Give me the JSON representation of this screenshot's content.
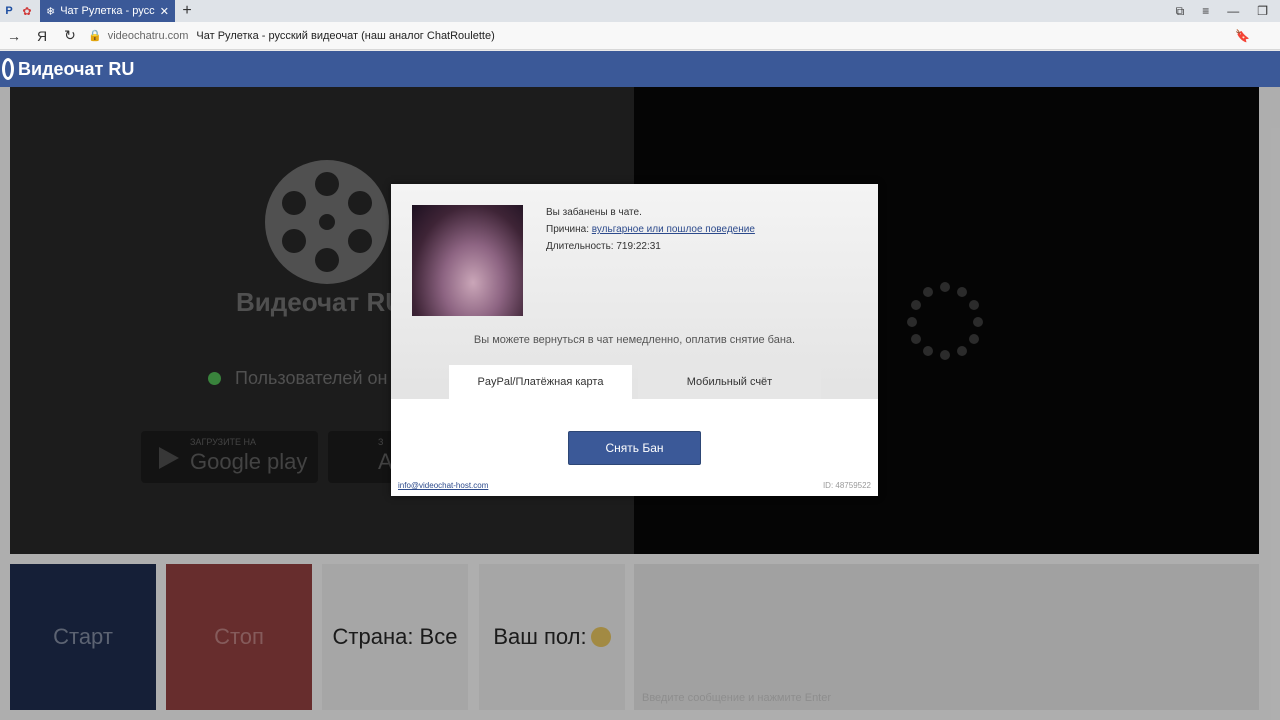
{
  "browser": {
    "tab_title": "Чат Рулетка - русский в",
    "tab_close": "✕",
    "new_tab": "+",
    "address_url": "videochatru.com",
    "address_title": "Чат Рулетка - русский видеочат (наш аналог ChatRoulette)"
  },
  "site": {
    "logo_text": "Видеочат RU",
    "big_logo_text": "Видеочат RU",
    "online_text": "Пользователей он",
    "google_play_small": "ЗАГРУЗИТЕ НА",
    "google_play_big": "Google play",
    "app_store_small": "З",
    "app_store_big": "A"
  },
  "controls": {
    "start": "Старт",
    "stop": "Стоп",
    "country": "Страна: Все",
    "gender": "Ваш пол:",
    "chat_placeholder": "Введите сообщение и нажмите Enter"
  },
  "modal": {
    "banned_line": "Вы забанены в чате.",
    "reason_label": "Причина:",
    "reason_link": "вульгарное или пошлое поведение",
    "duration_label": "Длительность:",
    "duration_value": "719:22:31",
    "message": "Вы можете вернуться в чат немедленно, оплатив снятие бана.",
    "tab_paypal": "PayPal/Платёжная карта",
    "tab_mobile": "Мобильный счёт",
    "unban_button": "Снять Бан",
    "email": "info@videochat-host.com",
    "id": "ID: 48759522"
  },
  "colors": {
    "brand": "#3b5998",
    "stop": "#8a3d3d",
    "online": "#4caf50"
  }
}
